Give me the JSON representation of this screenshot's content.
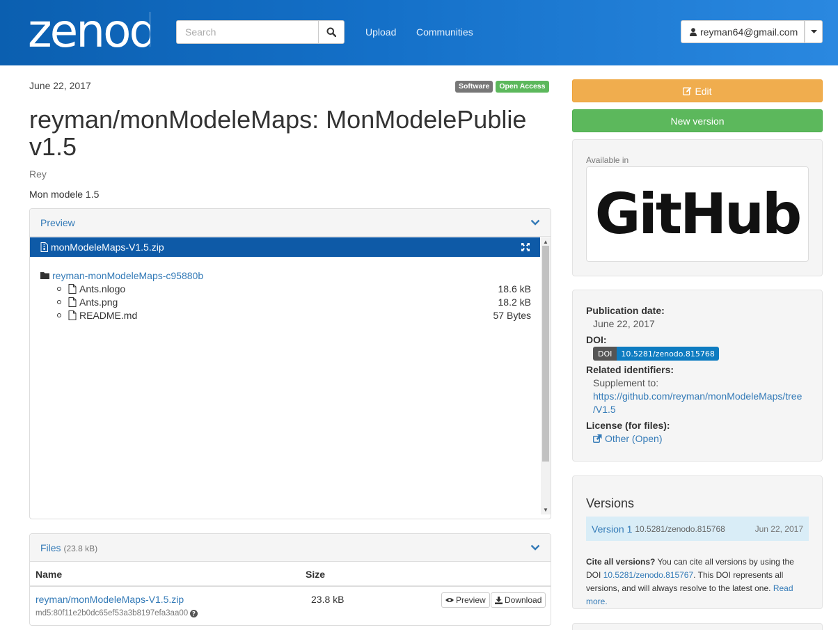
{
  "header": {
    "logo_text": "zenodo",
    "search_placeholder": "Search",
    "nav": [
      "Upload",
      "Communities"
    ],
    "user": "reyman64@gmail.com"
  },
  "record": {
    "date": "June 22, 2017",
    "badges": [
      "Software",
      "Open Access"
    ],
    "title": "reyman/monModeleMaps: MonModelePublie v1.5",
    "creator": "Rey",
    "description": "Mon modele 1.5"
  },
  "preview": {
    "heading": "Preview",
    "filename": "monModeleMaps-V1.5.zip",
    "folder": "reyman-monModeleMaps-c95880b",
    "files": [
      {
        "name": "Ants.nlogo",
        "size": "18.6 kB"
      },
      {
        "name": "Ants.png",
        "size": "18.2 kB"
      },
      {
        "name": "README.md",
        "size": "57 Bytes"
      }
    ]
  },
  "files": {
    "heading": "Files",
    "total": "(23.8 kB)",
    "col_name": "Name",
    "col_size": "Size",
    "rows": [
      {
        "name": "reyman/monModeleMaps-V1.5.zip",
        "md5": "md5:80f11e2b0dc65ef53a3b8197efa3aa00",
        "size": "23.8 kB",
        "preview_label": "Preview",
        "download_label": "Download"
      }
    ]
  },
  "sidebar": {
    "edit_label": "Edit",
    "new_version_label": "New version",
    "available_in": "Available in",
    "github_logo_text": "GitHub",
    "pub_date_label": "Publication date:",
    "pub_date": "June 22, 2017",
    "doi_label": "DOI:",
    "doi_badge_left": "DOI",
    "doi_badge_right": "10.5281/zenodo.815768",
    "related_label": "Related identifiers:",
    "supplement_label": "Supplement to:",
    "supplement_url_1": "https://github.com/reyman/monModeleMaps/tree",
    "supplement_url_2": "/V1.5",
    "license_label": "License (for files):",
    "license_value": "Other (Open)",
    "versions_heading": "Versions",
    "versions": [
      {
        "name": "Version 1",
        "doi": "10.5281/zenodo.815768",
        "date": "Jun 22, 2017"
      }
    ],
    "cite_bold": "Cite all versions?",
    "cite_text_1": "You can cite all versions by using the DOI",
    "cite_doi": "10.5281/zenodo.815767",
    "cite_text_2": ". This DOI represents all versions, and will always resolve to the latest one.",
    "read_more": "Read more."
  },
  "colors": {
    "header_start": "#0b5fb0",
    "header_end": "#2a88e0",
    "edit": "#f0ad4e",
    "new_version": "#5cb85c",
    "link": "#337ab7",
    "preview_bar": "#0e5aa7"
  }
}
